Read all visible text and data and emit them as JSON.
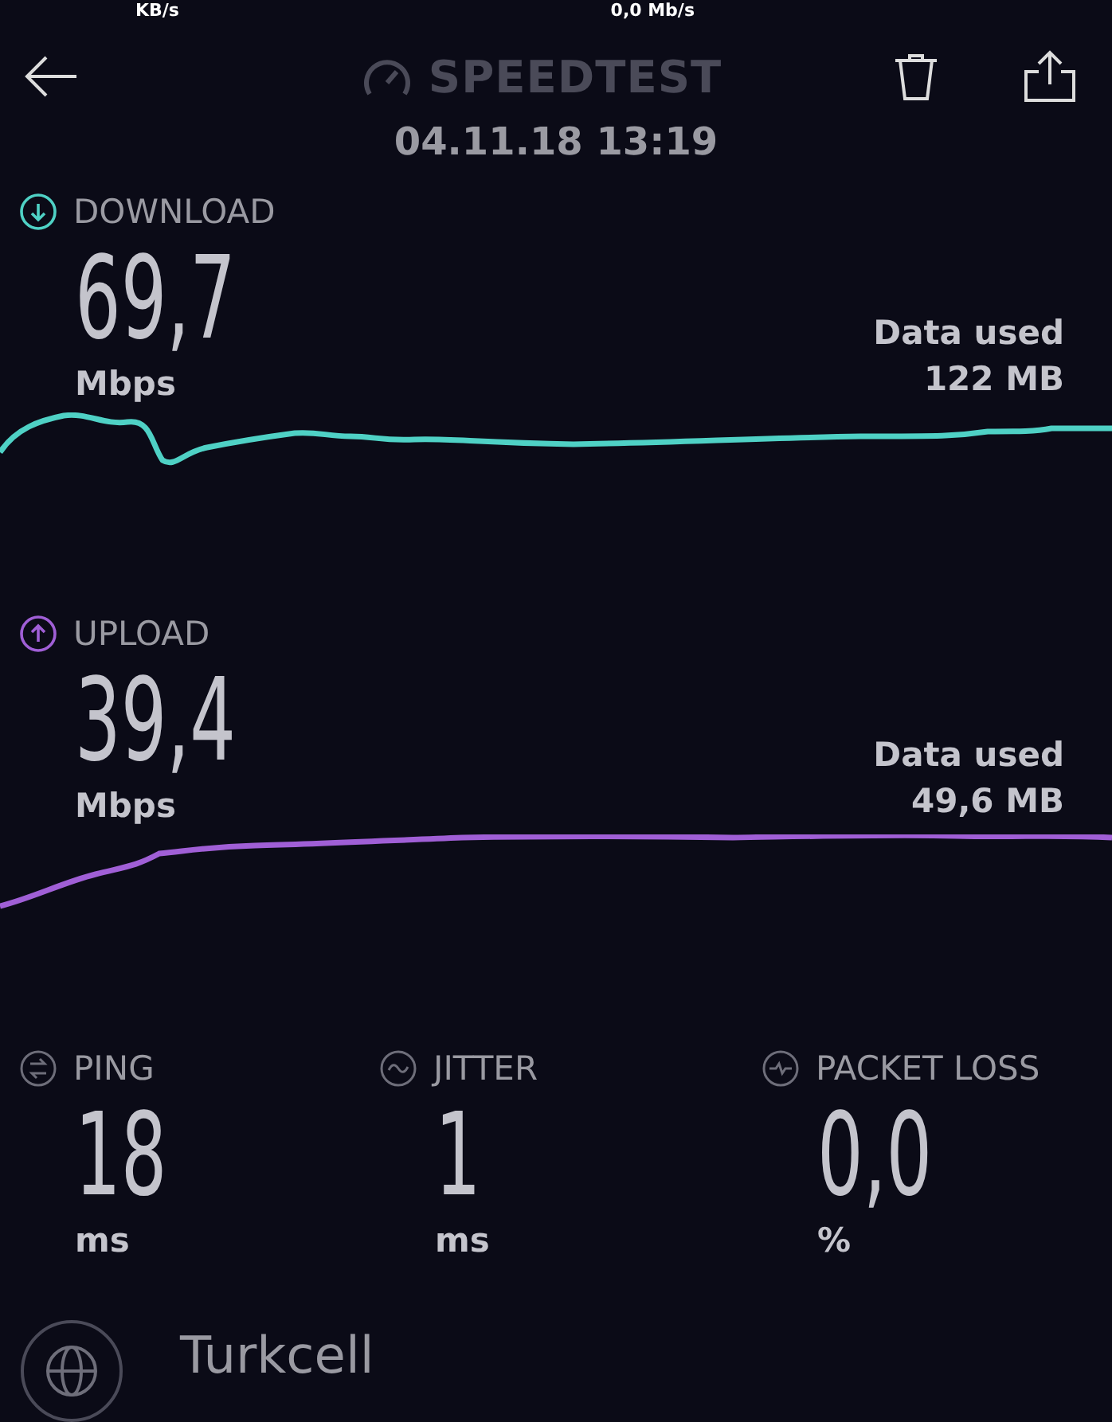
{
  "status_bar": {
    "left_rate": "KB/s",
    "right_rate": "0,0 Mb/s"
  },
  "header": {
    "title": "SPEEDTEST",
    "date": "04.11.18 13:19"
  },
  "results": [
    {
      "kind": "download",
      "label": "DOWNLOAD",
      "value": "69,7",
      "unit": "Mbps",
      "data_label": "Data used",
      "data_value": "122 MB",
      "color": "#4fd1c5"
    },
    {
      "kind": "upload",
      "label": "UPLOAD",
      "value": "39,4",
      "unit": "Mbps",
      "data_label": "Data used",
      "data_value": "49,6 MB",
      "color": "#a05fd6"
    }
  ],
  "metrics": [
    {
      "kind": "ping",
      "label": "PING",
      "value": "18",
      "unit": "ms"
    },
    {
      "kind": "jitter",
      "label": "JITTER",
      "value": "1",
      "unit": "ms"
    },
    {
      "kind": "loss",
      "label": "PACKET LOSS",
      "value": "0,0",
      "unit": "%"
    }
  ],
  "provider": {
    "name": "Turkcell"
  }
}
